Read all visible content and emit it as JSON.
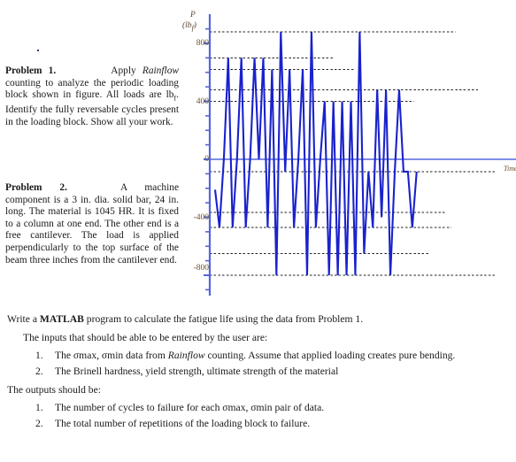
{
  "document": {
    "problem1": {
      "heading": "Problem  1.",
      "lead": "Apply",
      "body_before_italic": "",
      "italic_word": "Rainflow",
      "body": " counting to analyze the periodic loading block shown in figure. All loads are lb",
      "body_sub": "f",
      "body_rest": ".  Identify the fully reversable cycles present in the loading block. Show all your work."
    },
    "problem2": {
      "heading": "Problem  2.",
      "lead": "A machine",
      "body": "component is a 3 in. dia. solid bar, 24 in. long.   The material is 1045 HR. It is fixed to a column at one end.   The other end is a free cantilever.   The load is applied perpendicularly to the top surface of the beam three inches from the cantilever end."
    },
    "matlab_line": {
      "pre": "Write a ",
      "bold": "MATLAB",
      "post": " program to calculate the fatigue life using the data from Problem 1."
    },
    "inputs_heading": "The inputs that should be able to be entered by the user are:",
    "inputs": [
      {
        "num": "1.",
        "pre": "The σmax, σmin data from ",
        "italic": "Rainflow",
        "post": " counting. Assume that applied loading creates pure bending."
      },
      {
        "num": "2.",
        "pre": "The Brinell hardness, yield strength, ultimate strength of the material",
        "italic": "",
        "post": ""
      }
    ],
    "outputs_heading": "The outputs should be:",
    "outputs": [
      {
        "num": "1.",
        "pre": "The number of cycles to failure for each σmax, σmin pair of data.",
        "italic": "",
        "post": ""
      },
      {
        "num": "2.",
        "pre": "The total number of repetitions of the loading block to failure.",
        "italic": "",
        "post": ""
      }
    ]
  },
  "chart_data": {
    "type": "line",
    "title": "",
    "xlabel": "Time",
    "ylabel": "P",
    "ylabel_units": "(lb_f)",
    "ylabel_unit_main": "(lb",
    "ylabel_unit_sub": "f",
    "ylabel_unit_close": ")",
    "grid": true,
    "legend": "none",
    "ylim": [
      -900,
      900
    ],
    "xlim": [
      0,
      62
    ],
    "ytick_labels": [
      "800",
      "400",
      "0",
      "-400",
      "-800"
    ],
    "ytick_values": [
      800,
      400,
      0,
      -400,
      -800
    ],
    "minor_tick_values": [
      900,
      700,
      600,
      500,
      300,
      200,
      100,
      -100,
      -200,
      -300,
      -500,
      -600,
      -700,
      -900
    ],
    "reference_lines": [
      880,
      700,
      620,
      480,
      400,
      -85,
      -365,
      -470,
      -650,
      -800
    ],
    "line_color": "#1a22cc",
    "axis_color": "#5566dd",
    "series": [
      {
        "name": "P",
        "x": [
          0,
          1,
          2,
          3,
          4,
          5,
          6,
          7,
          8,
          9,
          10,
          11,
          12,
          13,
          14,
          15,
          16,
          17,
          18,
          19,
          20,
          21,
          22,
          23,
          24,
          25,
          26,
          27,
          28,
          29,
          30,
          31,
          32,
          33,
          34,
          35,
          36,
          37,
          38,
          39,
          40,
          41,
          42,
          43,
          44,
          45,
          46,
          47,
          48,
          49,
          50,
          51,
          52,
          53,
          54,
          55,
          56,
          57,
          58,
          59,
          60
        ],
        "values": [
          -210,
          -470,
          0,
          700,
          -470,
          0,
          700,
          -470,
          0,
          700,
          0,
          700,
          -470,
          620,
          -800,
          880,
          -85,
          620,
          -470,
          0,
          620,
          -800,
          880,
          -470,
          0,
          400,
          -800,
          400,
          -800,
          400,
          -800,
          400,
          -800,
          880,
          -650,
          -85,
          -470,
          480,
          -400,
          480,
          -800,
          -85,
          480,
          -85,
          -85,
          -470,
          -85
        ]
      }
    ]
  }
}
